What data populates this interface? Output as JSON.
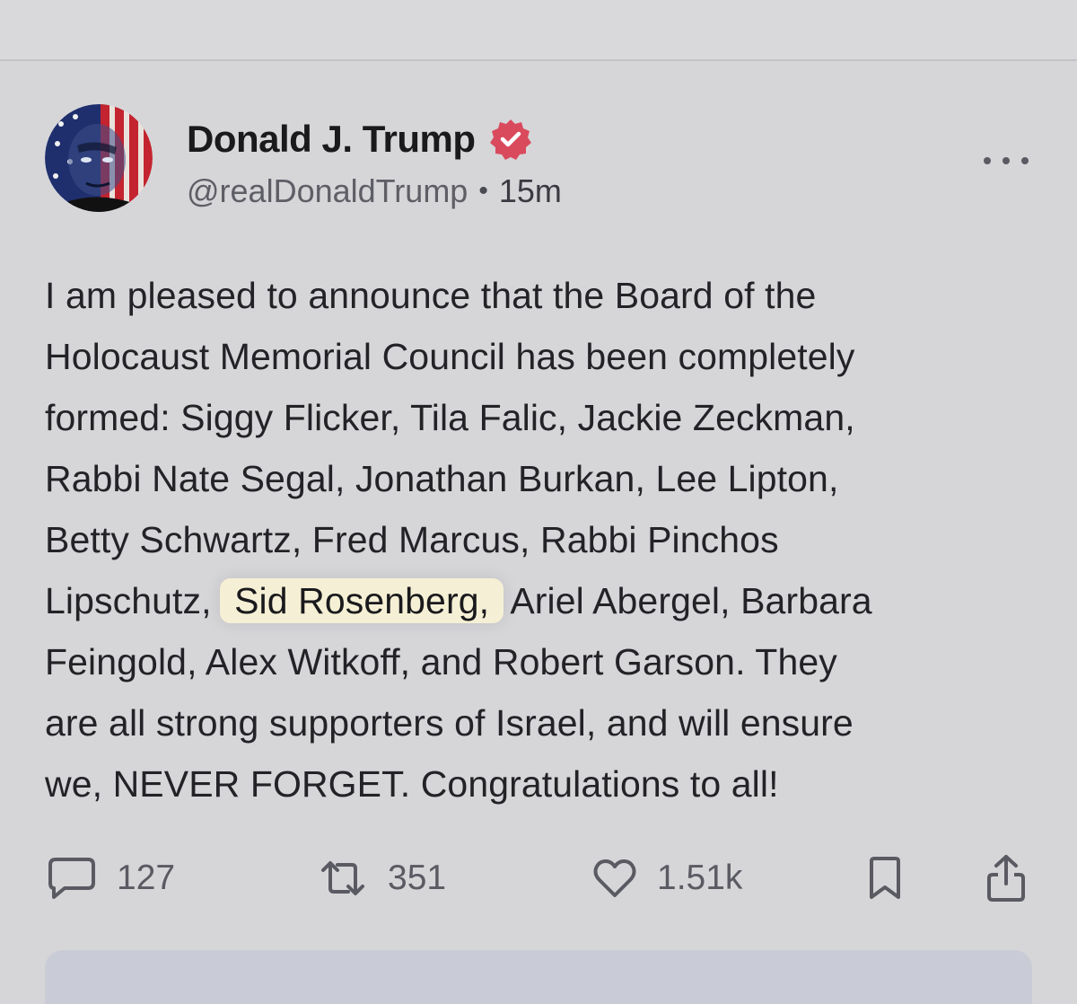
{
  "post": {
    "author": {
      "display_name": "Donald J. Trump",
      "handle": "@realDonaldTrump",
      "separator": "•",
      "time": "15m",
      "verified_icon": "verified-badge-icon",
      "avatar_icon": "avatar-image"
    },
    "text_lines": [
      "I am pleased to announce that the Board of the",
      "Holocaust Memorial Council has been completely",
      "formed: Siggy Flicker, Tila Falic, Jackie Zeckman,",
      "Rabbi Nate Segal, Jonathan Burkan, Lee Lipton,",
      "Betty Schwartz, Fred Marcus, Rabbi Pinchos",
      {
        "before": "Lipschutz, ",
        "highlighted": "Sid Rosenberg,",
        "after": " Ariel Abergel, Barbara"
      },
      "Feingold, Alex Witkoff, and Robert Garson. They",
      "are all strong supporters of Israel, and will ensure",
      "we, NEVER FORGET. Congratulations to all!"
    ],
    "actions": {
      "reply_count": "127",
      "repost_count": "351",
      "like_count": "1.51k"
    }
  },
  "colors": {
    "background": "#d6d6d9",
    "verified_badge": "#d94a5c",
    "highlight": "#f5f0d5",
    "text": "#232327",
    "muted": "#5e5e66"
  }
}
